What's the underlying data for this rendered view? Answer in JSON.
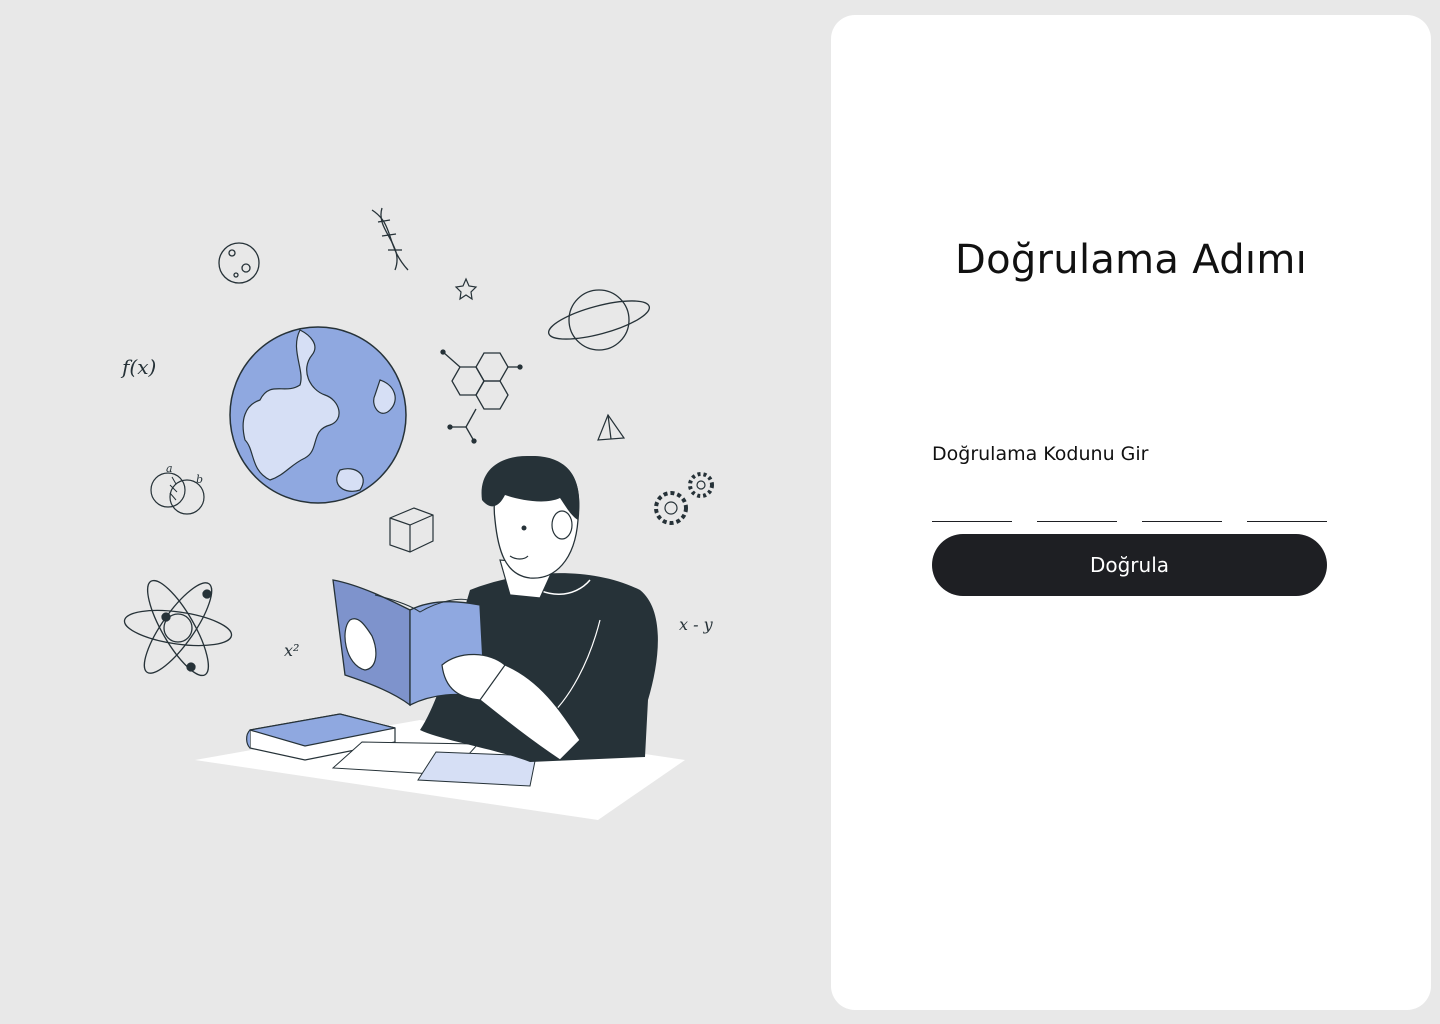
{
  "verification": {
    "title": "Doğrulama Adımı",
    "code_label": "Doğrulama Kodunu Gir",
    "code_values": [
      "",
      "",
      "",
      ""
    ],
    "button_label": "Doğrula"
  },
  "illustration": {
    "formula_function": "f(x)",
    "formula_square": "x²",
    "formula_difference": "x - y",
    "venn_label_a": "a",
    "venn_label_b": "b"
  },
  "colors": {
    "page_background": "#e8e8e8",
    "card_background": "#ffffff",
    "button_background": "#1e1f23",
    "button_text": "#ffffff",
    "accent_blue": "#8fa8e0",
    "light_blue": "#d6dff5",
    "shirt_dark": "#263238"
  },
  "icons": [
    "moon-icon",
    "dna-icon",
    "star-icon",
    "planet-icon",
    "molecule-icon",
    "pyramid-icon",
    "gears-icon",
    "venn-icon",
    "cube-icon",
    "atom-icon",
    "globe-icon"
  ]
}
